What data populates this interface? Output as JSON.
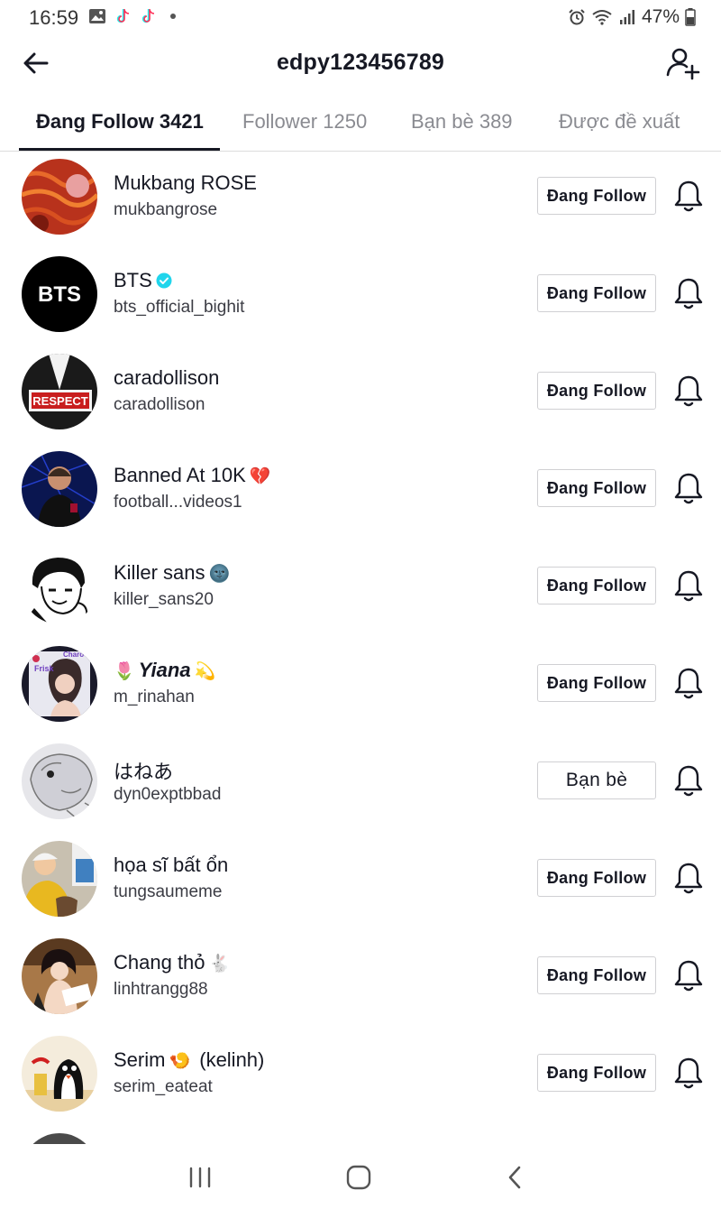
{
  "status_bar": {
    "time": "16:59",
    "battery": "47%"
  },
  "header": {
    "title": "edpy123456789"
  },
  "tabs": [
    {
      "label": "Đang Follow 3421"
    },
    {
      "label": "Follower 1250"
    },
    {
      "label": "Bạn bè 389"
    },
    {
      "label": "Được đề xuất"
    }
  ],
  "following": [
    {
      "name": "Mukbang ROSE",
      "username": "mukbangrose",
      "button": "Đang Follow"
    },
    {
      "name": "BTS",
      "username": "bts_official_bighit",
      "button": "Đang Follow",
      "verified": true
    },
    {
      "name": "caradollison",
      "username": "caradollison",
      "button": "Đang Follow"
    },
    {
      "name": "Banned At 10K",
      "name_emoji": "💔",
      "username": "football...videos1",
      "button": "Đang Follow"
    },
    {
      "name": "Killer sans",
      "name_emoji": "🌚",
      "username": "killer_sans20",
      "button": "Đang Follow"
    },
    {
      "name": "Yiana",
      "name_prefix_emoji": "🌷",
      "name_emoji": "💫",
      "username": "m_rinahan",
      "button": "Đang Follow"
    },
    {
      "name": "はねあ",
      "username": "dyn0exptbbad",
      "button": "Bạn bè"
    },
    {
      "name": "họa sĩ bất ổn",
      "username": "tungsaumeme",
      "button": "Đang Follow"
    },
    {
      "name": "Chang thỏ",
      "name_emoji": "🐇",
      "username": "linhtrangg88",
      "button": "Đang Follow"
    },
    {
      "name": "Serim",
      "name_emoji": "🍤",
      "name_suffix": " (kelinh)",
      "username": "serim_eateat",
      "button": "Đang Follow"
    }
  ],
  "avatar_texts": {
    "bts": "BTS",
    "respect": "RESPECT",
    "charo": "Charo",
    "frisk": "Frisk"
  },
  "colors": {
    "verified": "#20d5ec",
    "text_primary": "#161823",
    "tab_inactive": "#8a8b91",
    "heart_broken": "#e8336d"
  }
}
